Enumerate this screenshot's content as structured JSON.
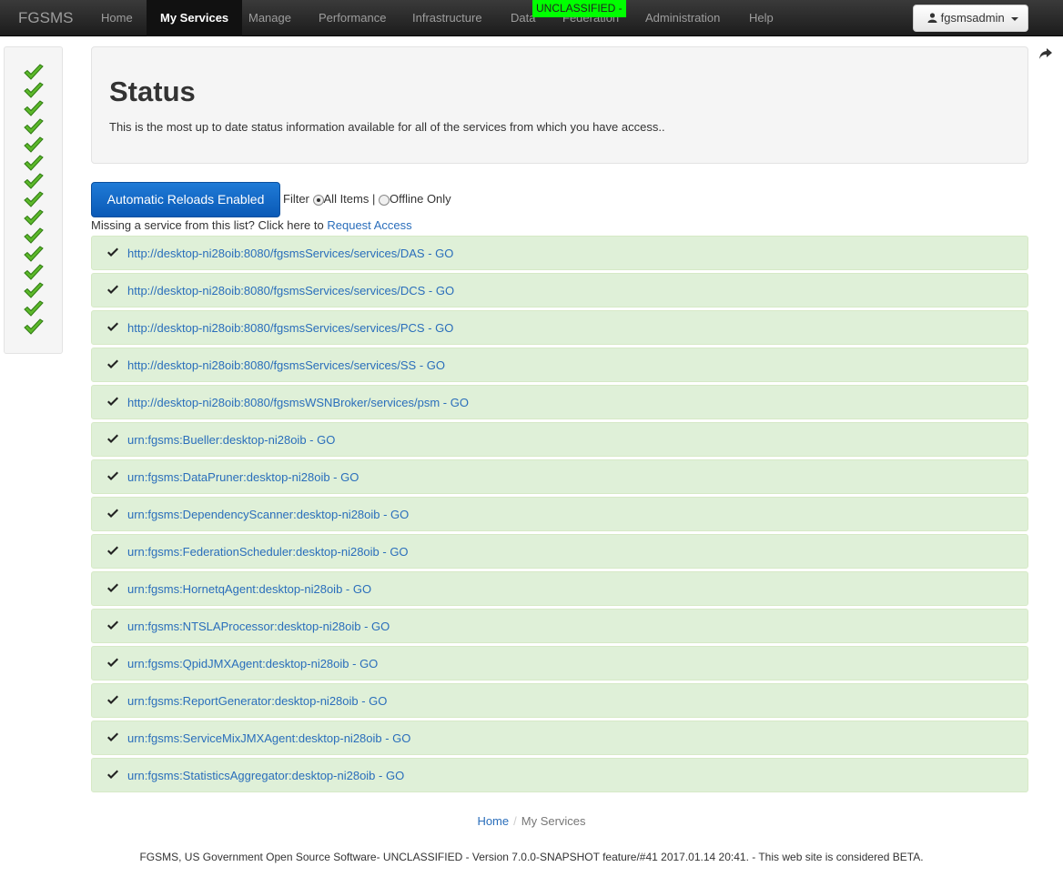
{
  "navbar": {
    "brand": "FGSMS",
    "items": [
      {
        "label": "Home"
      },
      {
        "label": "My Services"
      },
      {
        "label": "Manage"
      },
      {
        "label": "Performance"
      },
      {
        "label": "Infrastructure"
      },
      {
        "label": "Data"
      },
      {
        "label": "Federation"
      },
      {
        "label": "Administration"
      },
      {
        "label": "Help"
      }
    ],
    "active": "My Services",
    "classification": "UNCLASSIFIED -",
    "user": "fgsmsadmin"
  },
  "sidebar": {
    "check_count": 15,
    "icon": "green-checkmark-icon"
  },
  "header": {
    "title": "Status",
    "description": "This is the most up to date status information available for all of the services from which you have access.."
  },
  "controls": {
    "reload_button": "Automatic Reloads Enabled",
    "filter_label": "Filter",
    "filter_options": [
      "All Items",
      "Offline Only"
    ],
    "filter_selected": "All Items",
    "separator": "|",
    "missing_text": "Missing a service from this list? Click here to",
    "request_link": "Request Access"
  },
  "services": [
    "http://desktop-ni28oib:8080/fgsmsServices/services/DAS - GO",
    "http://desktop-ni28oib:8080/fgsmsServices/services/DCS - GO",
    "http://desktop-ni28oib:8080/fgsmsServices/services/PCS - GO",
    "http://desktop-ni28oib:8080/fgsmsServices/services/SS - GO",
    "http://desktop-ni28oib:8080/fgsmsWSNBroker/services/psm - GO",
    "urn:fgsms:Bueller:desktop-ni28oib - GO",
    "urn:fgsms:DataPruner:desktop-ni28oib - GO",
    "urn:fgsms:DependencyScanner:desktop-ni28oib - GO",
    "urn:fgsms:FederationScheduler:desktop-ni28oib - GO",
    "urn:fgsms:HornetqAgent:desktop-ni28oib - GO",
    "urn:fgsms:NTSLAProcessor:desktop-ni28oib - GO",
    "urn:fgsms:QpidJMXAgent:desktop-ni28oib - GO",
    "urn:fgsms:ReportGenerator:desktop-ni28oib - GO",
    "urn:fgsms:ServiceMixJMXAgent:desktop-ni28oib - GO",
    "urn:fgsms:StatisticsAggregator:desktop-ni28oib - GO"
  ],
  "breadcrumb": {
    "home": "Home",
    "separator": "/",
    "current": "My Services"
  },
  "footer": "FGSMS, US Government Open Source Software- UNCLASSIFIED - Version 7.0.0-SNAPSHOT feature/#41 2017.01.14 20:41. - This web site is considered BETA.",
  "colors": {
    "navbar": "#222222",
    "classification": "#00ff00",
    "reload_button": "#1066c6",
    "service_ok_bg": "#dff0d8",
    "link": "#2a6ebb",
    "check_green": "#5cb82a"
  }
}
